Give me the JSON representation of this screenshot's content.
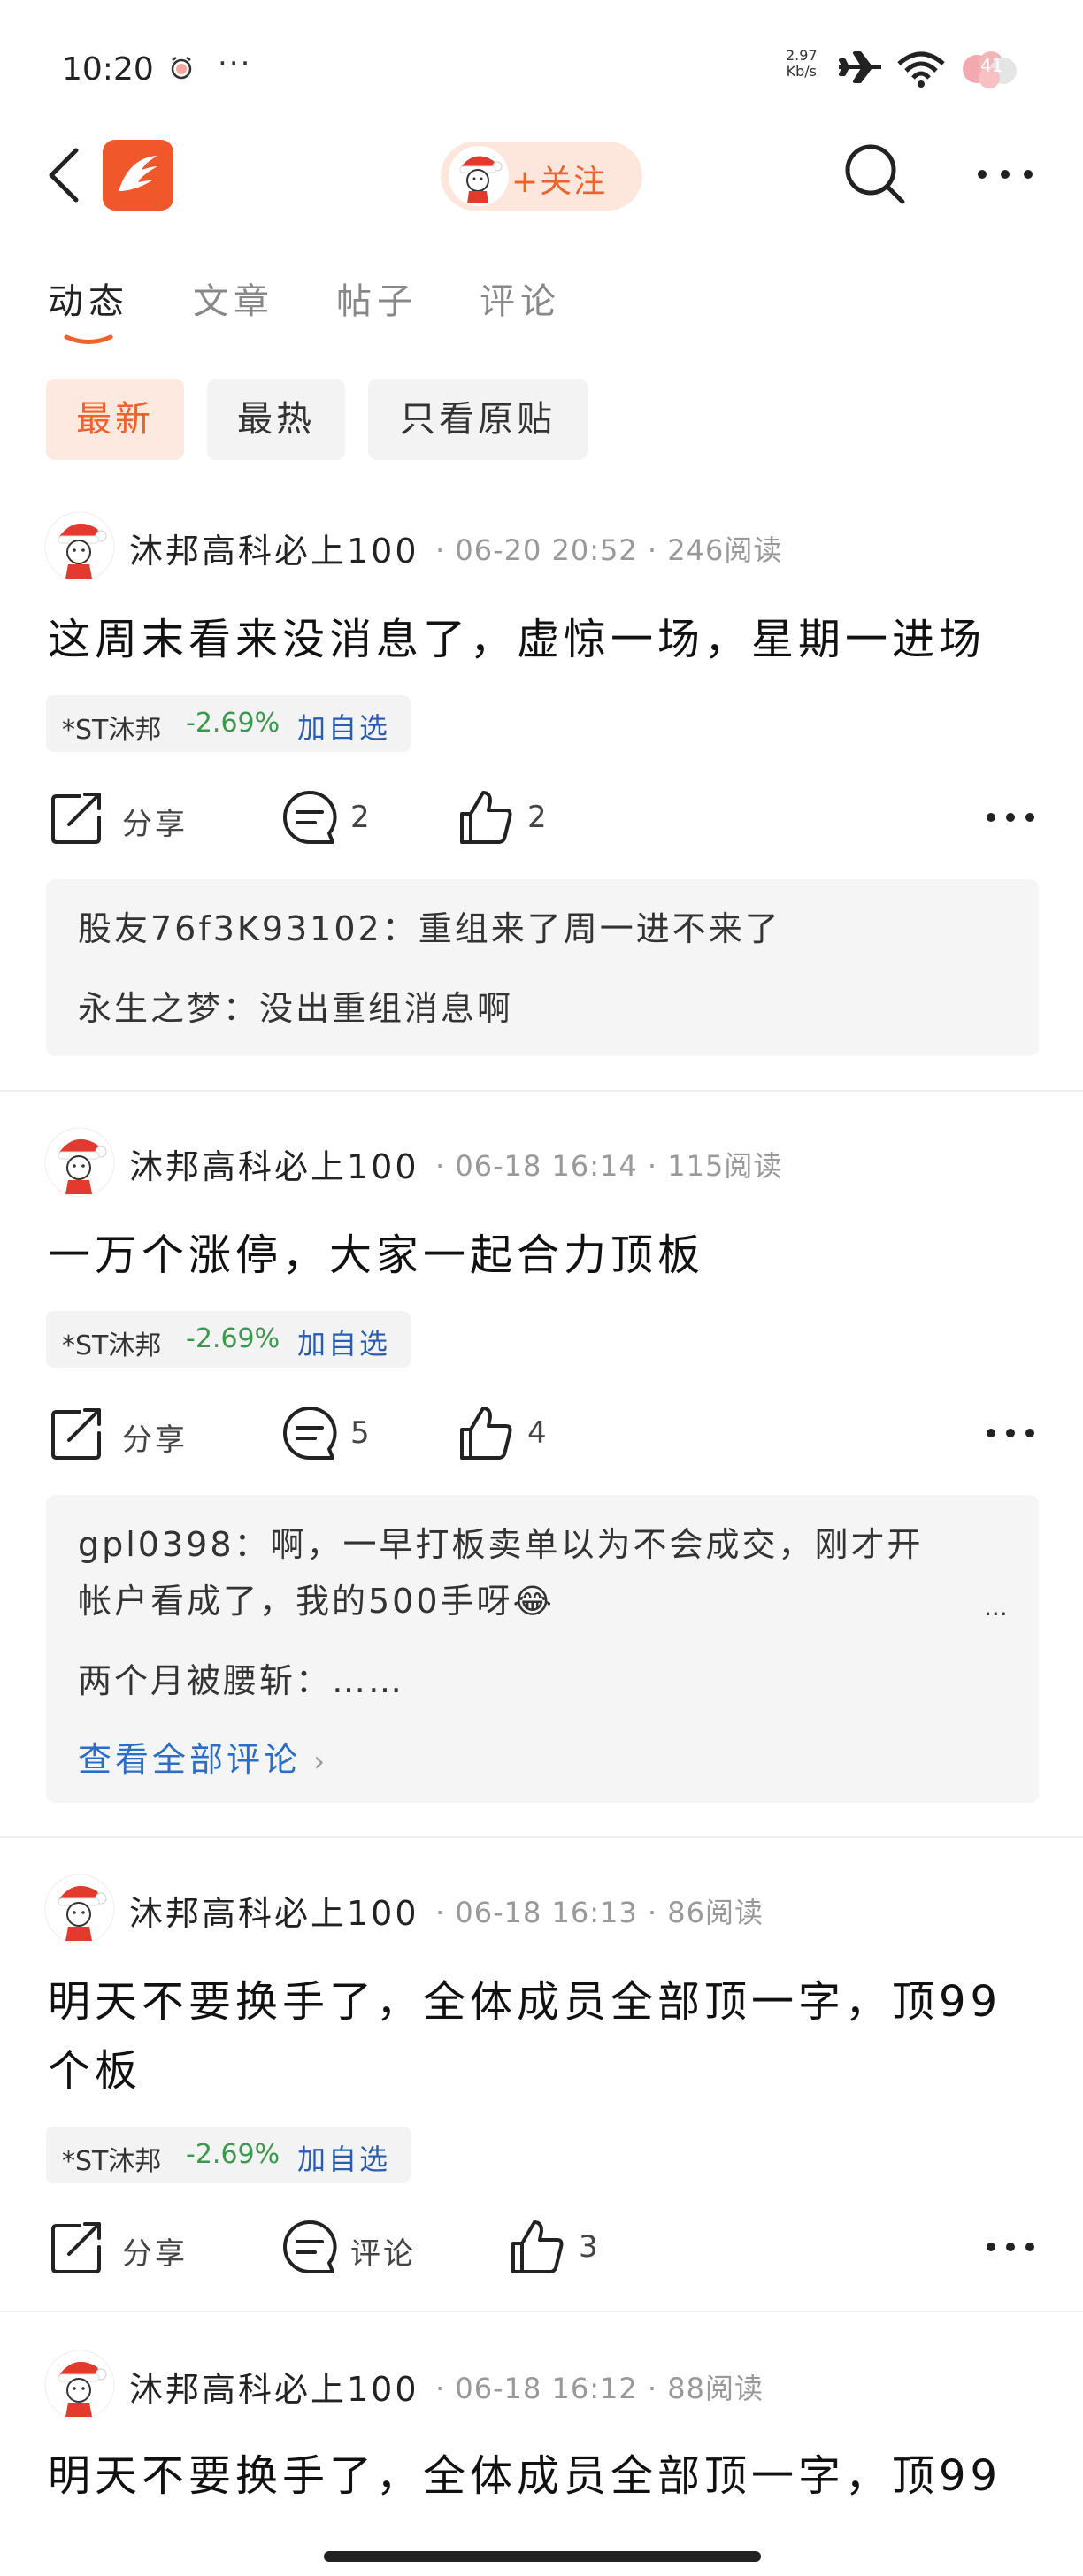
{
  "status_bar": {
    "time": "10:20",
    "dots": "···",
    "speed_top": "2.97",
    "speed_bottom": "Kb/s",
    "battery": "41"
  },
  "header": {
    "follow_label": "+关注"
  },
  "tabs": [
    {
      "label": "动态",
      "active": true
    },
    {
      "label": "文章"
    },
    {
      "label": "帖子"
    },
    {
      "label": "评论"
    }
  ],
  "filters": [
    {
      "label": "最新",
      "active": true
    },
    {
      "label": "最热"
    },
    {
      "label": "只看原贴"
    }
  ],
  "posts": [
    {
      "author": "沐邦高科必上100",
      "meta": "· 06-20 20:52 · 246阅读",
      "text": "这周末看来没消息了，虚惊一场，星期一进场",
      "stock_name": "*ST沐邦",
      "stock_change": "-2.69%",
      "stock_add": "加自选",
      "share": "分享",
      "comments": "2",
      "likes": "2",
      "comment_preview": [
        {
          "name": "股友76f3K93102：",
          "text": "重组来了周一进不来了"
        },
        {
          "name": "永生之梦：",
          "text": "没出重组消息啊"
        }
      ]
    },
    {
      "author": "沐邦高科必上100",
      "meta": "· 06-18 16:14 · 115阅读",
      "text": "一万个涨停，大家一起合力顶板",
      "stock_name": "*ST沐邦",
      "stock_change": "-2.69%",
      "stock_add": "加自选",
      "share": "分享",
      "comments": "5",
      "likes": "4",
      "comment_preview": [
        {
          "name": "gpl0398：",
          "text": "啊，一早打板卖单以为不会成交，刚才开",
          "text2": "帐户看成了，我的500手呀😂",
          "more": "..."
        },
        {
          "name": "两个月被腰斩：",
          "text": "……"
        }
      ],
      "view_all": "查看全部评论"
    },
    {
      "author": "沐邦高科必上100",
      "meta": "· 06-18 16:13 · 86阅读",
      "text": "明天不要换手了，全体成员全部顶一字，顶99",
      "text2": "个板",
      "stock_name": "*ST沐邦",
      "stock_change": "-2.69%",
      "stock_add": "加自选",
      "share": "分享",
      "comments": "评论",
      "likes": "3"
    },
    {
      "author": "沐邦高科必上100",
      "meta": "· 06-18 16:12 · 88阅读",
      "text": "明天不要换手了，全体成员全部顶一字，顶99"
    }
  ],
  "colors": {
    "accent": "#f0622b",
    "link": "#2a6ec8",
    "gain_loss": "#3a9a4b"
  }
}
